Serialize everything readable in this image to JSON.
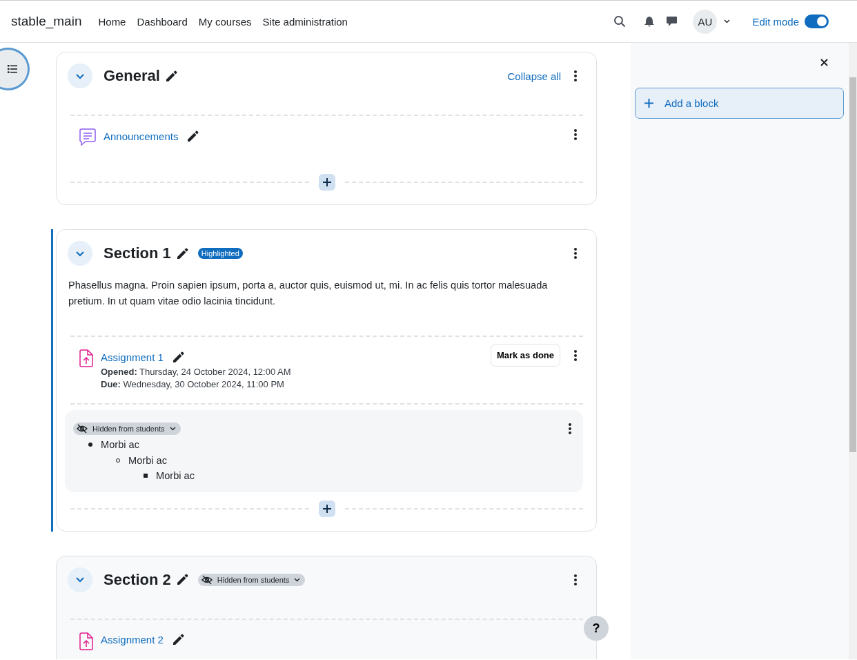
{
  "site_name": "stable_main",
  "nav": [
    {
      "label": "Home"
    },
    {
      "label": "Dashboard"
    },
    {
      "label": "My courses"
    },
    {
      "label": "Site administration"
    }
  ],
  "user": {
    "initials": "AU"
  },
  "edit_mode": {
    "label": "Edit mode",
    "on": true
  },
  "sections": [
    {
      "title": "General",
      "collapse_all": "Collapse all",
      "hidden": false,
      "highlighted": false,
      "activities": [
        {
          "kind": "forum",
          "name": "Announcements"
        }
      ]
    },
    {
      "title": "Section 1",
      "hidden": false,
      "highlighted": true,
      "highlighted_label": "Highlighted",
      "summary": "Phasellus magna. Proin sapien ipsum, porta a, auctor quis, euismod ut, mi. In ac felis quis tortor malesuada pretium. In ut quam vitae odio lacinia tincidunt.",
      "activities": [
        {
          "kind": "assign",
          "name": "Assignment 1",
          "dates": [
            "**Opened:** Thursday, 24 October 2024, 12:00 AM",
            "**Due:** Wednesday, 30 October 2024, 11:00 PM"
          ],
          "completion_button": "Mark as done"
        },
        {
          "kind": "text",
          "hidden": true,
          "visibility": "Hidden from students",
          "list": [
            {
              "text": "Morbi ac",
              "children": [
                {
                  "text": "Morbi ac",
                  "children": [
                    {
                      "text": "Morbi ac"
                    }
                  ]
                }
              ]
            }
          ]
        }
      ]
    },
    {
      "title": "Section 2",
      "hidden": true,
      "highlighted": false,
      "visibility": "Hidden from students",
      "activities": [
        {
          "kind": "assign",
          "name": "Assignment 2"
        }
      ]
    }
  ],
  "drawer": {
    "add_block": "Add a block"
  },
  "help": "?"
}
